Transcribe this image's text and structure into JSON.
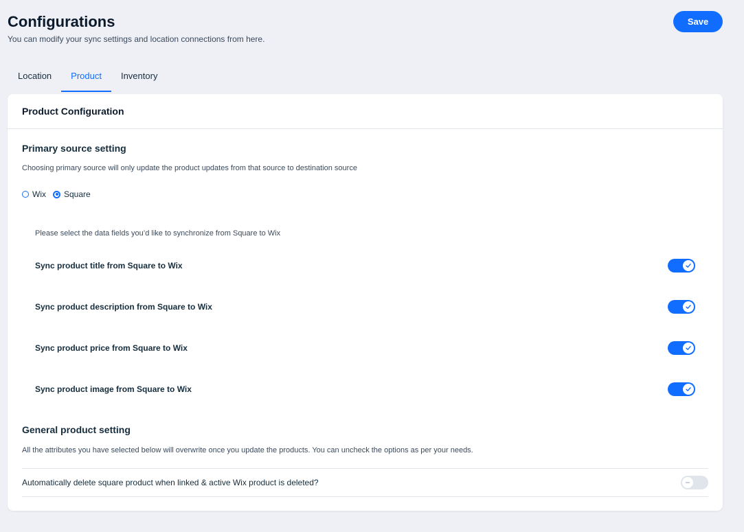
{
  "header": {
    "title": "Configurations",
    "subtitle": "You can modify your sync settings and location connections from here.",
    "save_label": "Save"
  },
  "tabs": [
    {
      "label": "Location",
      "active": false
    },
    {
      "label": "Product",
      "active": true
    },
    {
      "label": "Inventory",
      "active": false
    }
  ],
  "card": {
    "title": "Product Configuration",
    "primary_source": {
      "title": "Primary source setting",
      "description": "Choosing primary source will only update the product updates from that source to destination source",
      "options": [
        {
          "label": "Wix",
          "selected": false
        },
        {
          "label": "Square",
          "selected": true
        }
      ]
    },
    "sync": {
      "description": "Please select the data fields you’d like to synchronize from Square to Wix",
      "items": [
        {
          "label": "Sync product title from Square to Wix",
          "enabled": true
        },
        {
          "label": "Sync product description from Square to Wix",
          "enabled": true
        },
        {
          "label": "Sync product price from Square to Wix",
          "enabled": true
        },
        {
          "label": "Sync product image from Square to Wix",
          "enabled": true
        }
      ]
    },
    "general": {
      "title": "General product setting",
      "description": "All the attributes you have selected below will overwrite once you update the products. You can uncheck the options as per your needs.",
      "delete_label": "Automatically delete square product when linked & active Wix product is deleted?",
      "delete_enabled": false
    }
  },
  "colors": {
    "accent": "#116dff",
    "background": "#eef0f5",
    "toggle_off": "#dfe5eb"
  }
}
